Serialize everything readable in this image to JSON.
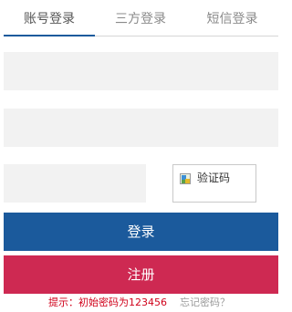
{
  "tabs": [
    {
      "label": "账号登录",
      "active": true
    },
    {
      "label": "三方登录",
      "active": false
    },
    {
      "label": "短信登录",
      "active": false
    }
  ],
  "form": {
    "username_value": "",
    "password_value": "",
    "captcha_value": "",
    "captcha_image_alt": "验证码"
  },
  "buttons": {
    "login_label": "登录",
    "register_label": "注册"
  },
  "footer": {
    "hint": "提示：初始密码为123456",
    "forgot_link": "忘记密码？"
  },
  "colors": {
    "primary": "#1b5a9c",
    "register": "#ce2952",
    "hint": "#d0021b",
    "field_bg": "#f2f2f2"
  }
}
